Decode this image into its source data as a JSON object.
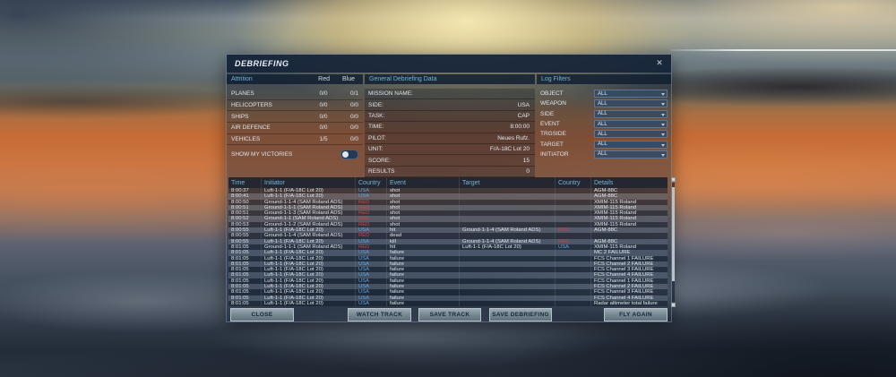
{
  "window": {
    "title": "DEBRIEFING",
    "close_glyph": "✕"
  },
  "attrition": {
    "header": "Attrition",
    "col_red": "Red",
    "col_blue": "Blue",
    "rows": [
      {
        "label": "PLANES",
        "red": "0/0",
        "blue": "0/1"
      },
      {
        "label": "HELICOPTERS",
        "red": "0/0",
        "blue": "0/0"
      },
      {
        "label": "SHIPS",
        "red": "0/0",
        "blue": "0/0"
      },
      {
        "label": "AIR DEFENCE",
        "red": "0/0",
        "blue": "0/0"
      },
      {
        "label": "VEHICLES",
        "red": "1/5",
        "blue": "0/0"
      }
    ],
    "show_my_victories_label": "SHOW MY VICTORIES",
    "toggle_state": "off"
  },
  "general": {
    "header": "General Debriefing Data",
    "fields": [
      {
        "label": "MISSION NAME:",
        "value": ""
      },
      {
        "label": "SIDE:",
        "value": "USA"
      },
      {
        "label": "TASK:",
        "value": "CAP"
      },
      {
        "label": "TIME:",
        "value": "8:00:00"
      },
      {
        "label": "PILOT:",
        "value": "Neues Rufz."
      },
      {
        "label": "UNIT:",
        "value": "F/A-18C Lot 20"
      },
      {
        "label": "SCORE:",
        "value": "15"
      },
      {
        "label": "RESULTS",
        "value": "0"
      }
    ]
  },
  "log_filters": {
    "header": "Log Filters",
    "filters": [
      {
        "label": "OBJECT",
        "value": "ALL"
      },
      {
        "label": "WEAPON",
        "value": "ALL"
      },
      {
        "label": "SIDE",
        "value": "ALL"
      },
      {
        "label": "EVENT",
        "value": "ALL"
      },
      {
        "label": "TRGSIDE",
        "value": "ALL"
      },
      {
        "label": "TARGET",
        "value": "ALL"
      },
      {
        "label": "INITIATOR",
        "value": "ALL"
      }
    ]
  },
  "log_table": {
    "columns": {
      "time": "Time",
      "initiator": "Initiator",
      "country": "Country",
      "event": "Event",
      "target": "Target",
      "country2": "Country",
      "details": "Details"
    },
    "rows": [
      {
        "time": "8:00:37",
        "initiator": "Luft-1-1 (F/A-18C Lot 20)",
        "country": "USA",
        "event": "shot",
        "target": "",
        "target_country": "",
        "details": "AGM-88C"
      },
      {
        "time": "8:00:41",
        "initiator": "Luft-1-1 (F/A-18C Lot 20)",
        "country": "USA",
        "event": "shot",
        "target": "",
        "target_country": "",
        "details": "AGM-88C"
      },
      {
        "time": "8:00:50",
        "initiator": "Ground-1-1-4 (SAM Roland ADS)",
        "country": "RED",
        "event": "shot",
        "target": "",
        "target_country": "",
        "details": "XMIM-115 Roland"
      },
      {
        "time": "8:00:51",
        "initiator": "Ground-1-1-1 (SAM Roland ADS)",
        "country": "RED",
        "event": "shot",
        "target": "",
        "target_country": "",
        "details": "XMIM-115 Roland"
      },
      {
        "time": "8:00:51",
        "initiator": "Ground-1-1-3 (SAM Roland ADS)",
        "country": "RED",
        "event": "shot",
        "target": "",
        "target_country": "",
        "details": "XMIM-115 Roland"
      },
      {
        "time": "8:00:52",
        "initiator": "Ground-1-1 (SAM Roland ADS)",
        "country": "RED",
        "event": "shot",
        "target": "",
        "target_country": "",
        "details": "XMIM-115 Roland"
      },
      {
        "time": "8:00:53",
        "initiator": "Ground-1-1-2 (SAM Roland ADS)",
        "country": "RED",
        "event": "shot",
        "target": "",
        "target_country": "",
        "details": "XMIM-115 Roland"
      },
      {
        "time": "8:00:55",
        "initiator": "Luft-1-1 (F/A-18C Lot 20)",
        "country": "USA",
        "event": "hit",
        "target": "Ground-1-1-4 (SAM Roland ADS)",
        "target_country": "RED",
        "details": "AGM-88C"
      },
      {
        "time": "8:00:55",
        "initiator": "Ground-1-1-4 (SAM Roland ADS)",
        "country": "RED",
        "event": "dead",
        "target": "",
        "target_country": "",
        "details": ""
      },
      {
        "time": "8:00:55",
        "initiator": "Luft-1-1 (F/A-18C Lot 20)",
        "country": "USA",
        "event": "kill",
        "target": "Ground-1-1-4 (SAM Roland ADS)",
        "target_country": "RED",
        "details": "AGM-88C"
      },
      {
        "time": "8:01:05",
        "initiator": "Ground-1-1-1 (SAM Roland ADS)",
        "country": "RED",
        "event": "hit",
        "target": "Luft-1-1 (F/A-18C Lot 20)",
        "target_country": "USA",
        "details": "XMIM-115 Roland"
      },
      {
        "time": "8:01:05",
        "initiator": "Luft-1-1 (F/A-18C Lot 20)",
        "country": "USA",
        "event": "failure",
        "target": "",
        "target_country": "",
        "details": "MC 2 FAILURE"
      },
      {
        "time": "8:01:05",
        "initiator": "Luft-1-1 (F/A-18C Lot 20)",
        "country": "USA",
        "event": "failure",
        "target": "",
        "target_country": "",
        "details": "FCS Channel 1 FAILURE"
      },
      {
        "time": "8:01:05",
        "initiator": "Luft-1-1 (F/A-18C Lot 20)",
        "country": "USA",
        "event": "failure",
        "target": "",
        "target_country": "",
        "details": "FCS Channel 2 FAILURE"
      },
      {
        "time": "8:01:05",
        "initiator": "Luft-1-1 (F/A-18C Lot 20)",
        "country": "USA",
        "event": "failure",
        "target": "",
        "target_country": "",
        "details": "FCS Channel 3 FAILURE"
      },
      {
        "time": "8:01:05",
        "initiator": "Luft-1-1 (F/A-18C Lot 20)",
        "country": "USA",
        "event": "failure",
        "target": "",
        "target_country": "",
        "details": "FCS Channel 4 FAILURE"
      },
      {
        "time": "8:01:05",
        "initiator": "Luft-1-1 (F/A-18C Lot 20)",
        "country": "USA",
        "event": "failure",
        "target": "",
        "target_country": "",
        "details": "FCS Channel 1 FAILURE"
      },
      {
        "time": "8:01:05",
        "initiator": "Luft-1-1 (F/A-18C Lot 20)",
        "country": "USA",
        "event": "failure",
        "target": "",
        "target_country": "",
        "details": "FCS Channel 2 FAILURE"
      },
      {
        "time": "8:01:05",
        "initiator": "Luft-1-1 (F/A-18C Lot 20)",
        "country": "USA",
        "event": "failure",
        "target": "",
        "target_country": "",
        "details": "FCS Channel 3 FAILURE"
      },
      {
        "time": "8:01:05",
        "initiator": "Luft-1-1 (F/A-18C Lot 20)",
        "country": "USA",
        "event": "failure",
        "target": "",
        "target_country": "",
        "details": "FCS Channel 4 FAILURE"
      },
      {
        "time": "8:01:05",
        "initiator": "Luft-1-1 (F/A-18C Lot 20)",
        "country": "USA",
        "event": "failure",
        "target": "",
        "target_country": "",
        "details": "Radar altimeter total failure"
      }
    ]
  },
  "buttons": {
    "close": "CLOSE",
    "watch_track": "WATCH TRACK",
    "save_track": "SAVE TRACK",
    "save_debriefing": "SAVE DEBRIEFING",
    "fly_again": "FLY AGAIN"
  },
  "colors": {
    "accent_cyan": "#6fb6d8",
    "usa_blue": "#5e9fd8",
    "red_side": "#c04444",
    "titlebar": "#16243a",
    "button_face": "#7b8b95"
  }
}
